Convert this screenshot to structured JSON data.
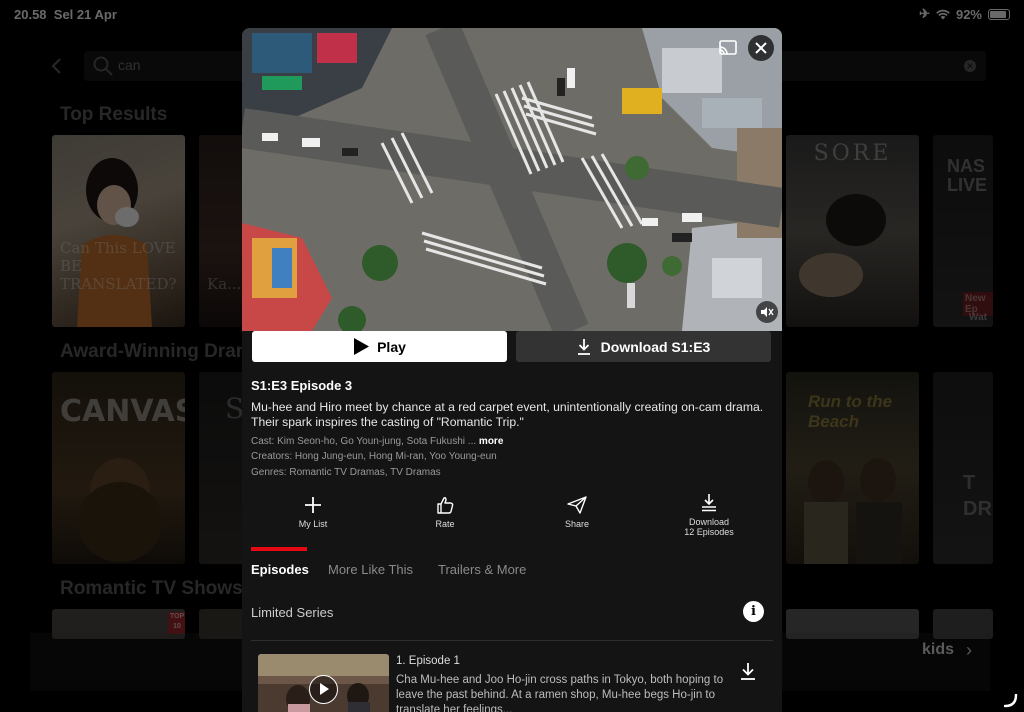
{
  "status_bar": {
    "time": "20.58",
    "date": "Sel 21 Apr",
    "battery": "92%"
  },
  "search": {
    "query": "can"
  },
  "sections": [
    {
      "title": "Top Results"
    },
    {
      "title": "Award-Winning Dran"
    },
    {
      "title": "Romantic TV Shows"
    }
  ],
  "tiles": {
    "top_row": [
      "Can This LOVE BE TRANSLATED?",
      "Ka... Con...",
      "SORE",
      "NAS LIVE"
    ],
    "mid_row": [
      "CANVAS",
      "S",
      "Run to the Beach",
      "T DRE"
    ],
    "badges": {
      "new_label": "New Ep",
      "wat": "Wat",
      "top10": "TOP 10"
    }
  },
  "kids": {
    "label": "kids"
  },
  "modal": {
    "play_label": "Play",
    "download_label": "Download S1:E3",
    "episode_title": "S1:E3 Episode 3",
    "description": "Mu-hee and Hiro meet by chance at a red carpet event, unintentionally creating on-cam drama. Their spark inspires the casting of \"Romantic Trip.\"",
    "cast": "Cast: Kim Seon-ho, Go Youn-jung, Sota Fukushi ...",
    "more": "more",
    "creators": "Creators: Hong Jung-eun, Hong Mi-ran, Yoo Young-eun",
    "genres": "Genres: Romantic TV Dramas, TV Dramas",
    "actions": {
      "my_list": "My List",
      "rate": "Rate",
      "share": "Share",
      "download_line1": "Download",
      "download_line2": "12 Episodes"
    },
    "tabs": [
      "Episodes",
      "More Like This",
      "Trailers & More"
    ],
    "series_type": "Limited Series",
    "episodes": [
      {
        "title": "1. Episode 1",
        "description": "Cha Mu-hee and Joo Ho-jin cross paths in Tokyo, both hoping to leave the past behind. At a ramen shop, Mu-hee begs Ho-jin to translate her feelings..."
      }
    ]
  },
  "colors": {
    "accent": "#e50914",
    "modal_bg": "#141414",
    "secondary_button": "#333333"
  }
}
